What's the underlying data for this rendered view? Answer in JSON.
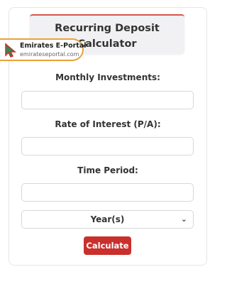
{
  "header": {
    "title_line1": "Recurring Deposit",
    "title_line2": "Calculator"
  },
  "logo": {
    "brand": "Emirates E-Portal",
    "url": "emirateseportal.com"
  },
  "fields": {
    "monthly_label": "Monthly Investments:",
    "rate_label": "Rate of Interest (P/A):",
    "period_label": "Time Period:",
    "monthly_value": "",
    "rate_value": "",
    "period_value": ""
  },
  "select": {
    "selected": "Year(s)"
  },
  "actions": {
    "calculate": "Calculate"
  },
  "colors": {
    "accent": "#c9302c",
    "logo_border": "#e7a23a"
  }
}
